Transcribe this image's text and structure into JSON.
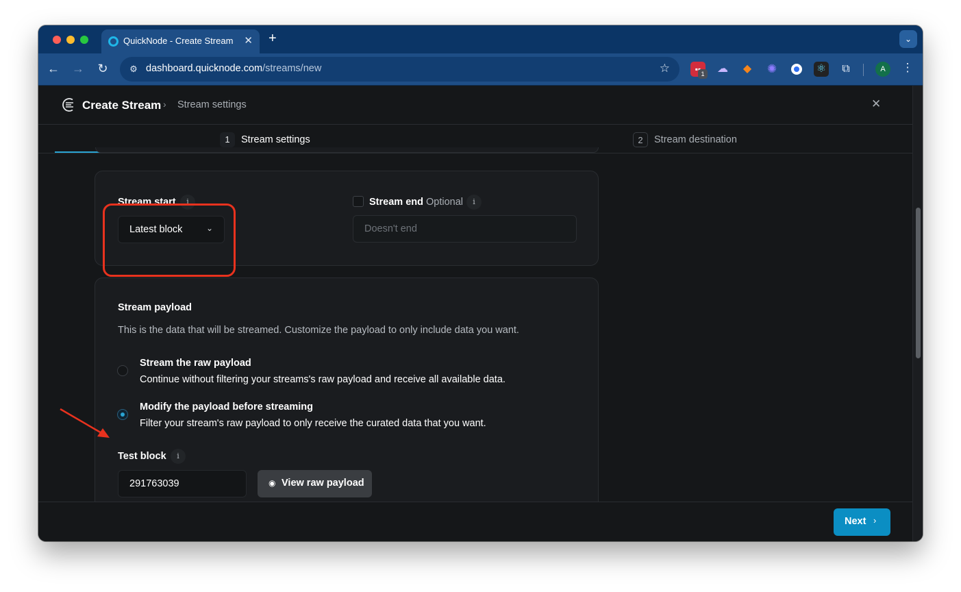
{
  "browser": {
    "tab_title": "QuickNode - Create Stream",
    "tab_close": "✕",
    "new_tab": "+",
    "url_domain": "dashboard.quicknode.com",
    "url_path": "/streams/new",
    "extension_badge": "1",
    "profile_initial": "A"
  },
  "header": {
    "title": "Create Stream",
    "breadcrumb_separator": "›",
    "breadcrumb": "Stream settings",
    "close": "✕"
  },
  "steps": [
    {
      "number": "1",
      "label": "Stream settings",
      "active": true
    },
    {
      "number": "2",
      "label": "Stream destination",
      "active": false
    }
  ],
  "stream_range": {
    "start_label": "Stream start",
    "start_value": "Latest block",
    "end_label": "Stream end",
    "end_optional": "Optional",
    "end_placeholder": "Doesn't end",
    "info": "i"
  },
  "payload": {
    "title": "Stream payload",
    "description": "This is the data that will be streamed. Customize the payload to only include data you want.",
    "options": [
      {
        "title": "Stream the raw payload",
        "description": "Continue without filtering your streams's raw payload and receive all available data.",
        "selected": false
      },
      {
        "title": "Modify the payload before streaming",
        "description": "Filter your stream's raw payload to only receive the curated data that you want.",
        "selected": true
      }
    ],
    "test_block_label": "Test block",
    "test_block_value": "291763039",
    "view_raw_label": "View raw payload"
  },
  "footer": {
    "next_label": "Next"
  },
  "colors": {
    "accent": "#2aa4d4",
    "next_button": "#0b8ec3",
    "annotation": "#e8321e",
    "chrome_frame": "#1e4e86"
  }
}
